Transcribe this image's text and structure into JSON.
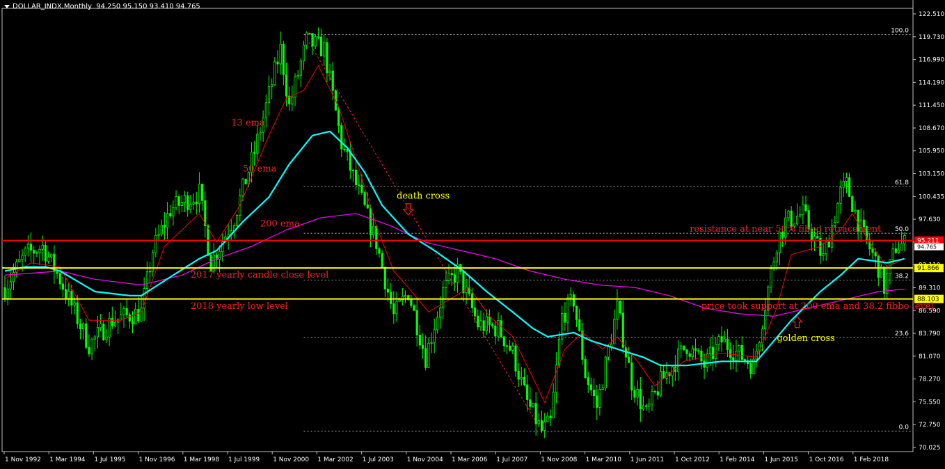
{
  "header": {
    "symbol": "DOLLAR_INDX,Monthly",
    "ohlc": "94.250 95.150 93.410 94.765"
  },
  "colors": {
    "background": "#000000",
    "candle": "#00ff00",
    "ema13": "#ff0000",
    "ema50": "#00ffff",
    "ema200": "#ff00ff",
    "resistance_line": "#ff0000",
    "yearly_lines": "#ffff00",
    "fibo": "#ffffff",
    "annotation_red": "#ff2020",
    "annotation_yellow": "#ffff00"
  },
  "chart_data": {
    "type": "candlestick",
    "title": "DOLLAR_INDX,Monthly",
    "ylim": [
      70.025,
      122.8
    ],
    "xlim": [
      "1992-11",
      "2018-10"
    ],
    "y_ticks": [
      "122.510",
      "119.730",
      "116.990",
      "114.190",
      "111.450",
      "108.670",
      "105.950",
      "103.150",
      "100.435",
      "97.630",
      "94.880",
      "92.110",
      "89.310",
      "86.590",
      "83.790",
      "81.070",
      "78.270",
      "75.550",
      "72.750",
      "70.025"
    ],
    "x_ticks": [
      "1 Nov 1992",
      "1 Mar 1994",
      "1 Jul 1995",
      "1 Nov 1996",
      "1 Mar 1998",
      "1 Jul 1999",
      "1 Nov 2000",
      "1 Mar 2002",
      "1 Jul 2003",
      "1 Nov 2004",
      "1 Mar 2006",
      "1 Jul 2007",
      "1 Nov 2008",
      "1 Mar 2010",
      "1 Jun 2011",
      "1 Oct 2012",
      "1 Feb 2014",
      "1 Jun 2015",
      "1 Oct 2016",
      "1 Feb 2018"
    ],
    "price_path": [
      [
        "1992-11",
        89.5
      ],
      [
        "1993-06",
        93.5
      ],
      [
        "1993-12",
        94.5
      ],
      [
        "1994-06",
        90.5
      ],
      [
        "1995-04",
        82.5
      ],
      [
        "1995-12",
        85.5
      ],
      [
        "1996-10",
        86.5
      ],
      [
        "1997-02",
        94.0
      ],
      [
        "1997-08",
        99.0
      ],
      [
        "1998-06",
        101.0
      ],
      [
        "1998-10",
        92.5
      ],
      [
        "1999-06",
        98.0
      ],
      [
        "2000-01",
        106.0
      ],
      [
        "2000-10",
        118.5
      ],
      [
        "2001-01",
        111.5
      ],
      [
        "2001-07",
        119.5
      ],
      [
        "2002-01",
        118.5
      ],
      [
        "2002-07",
        107.0
      ],
      [
        "2003-01",
        101.0
      ],
      [
        "2003-07",
        95.0
      ],
      [
        "2004-01",
        86.0
      ],
      [
        "2004-06",
        89.0
      ],
      [
        "2004-12",
        81.0
      ],
      [
        "2005-06",
        89.0
      ],
      [
        "2005-11",
        91.5
      ],
      [
        "2006-06",
        85.0
      ],
      [
        "2007-01",
        84.5
      ],
      [
        "2007-06",
        81.5
      ],
      [
        "2007-11",
        75.5
      ],
      [
        "2008-04",
        72.0
      ],
      [
        "2008-07",
        73.0
      ],
      [
        "2008-11",
        86.0
      ],
      [
        "2009-03",
        88.0
      ],
      [
        "2009-07",
        79.0
      ],
      [
        "2009-11",
        75.0
      ],
      [
        "2010-06",
        87.0
      ],
      [
        "2010-11",
        78.0
      ],
      [
        "2011-04",
        74.0
      ],
      [
        "2011-09",
        78.0
      ],
      [
        "2012-06",
        82.5
      ],
      [
        "2012-12",
        80.0
      ],
      [
        "2013-06",
        83.0
      ],
      [
        "2014-05",
        80.0
      ],
      [
        "2015-01",
        95.0
      ],
      [
        "2015-04",
        97.5
      ],
      [
        "2015-10",
        98.5
      ],
      [
        "2016-05",
        93.0
      ],
      [
        "2016-11",
        101.0
      ],
      [
        "2017-01",
        102.0
      ],
      [
        "2017-06",
        96.5
      ],
      [
        "2017-12",
        92.0
      ],
      [
        "2018-02",
        89.5
      ],
      [
        "2018-06",
        94.5
      ],
      [
        "2018-09",
        94.765
      ]
    ],
    "ema13": [
      [
        "1992-11",
        90.5
      ],
      [
        "1993-08",
        92.5
      ],
      [
        "1994-06",
        92.0
      ],
      [
        "1995-04",
        85.5
      ],
      [
        "1996-03",
        85.5
      ],
      [
        "1996-10",
        86.5
      ],
      [
        "1997-06",
        94.5
      ],
      [
        "1998-06",
        98.5
      ],
      [
        "1998-12",
        95.0
      ],
      [
        "1999-08",
        99.5
      ],
      [
        "2000-06",
        108.0
      ],
      [
        "2000-12",
        112.5
      ],
      [
        "2001-06",
        113.5
      ],
      [
        "2001-11",
        116.5
      ],
      [
        "2002-06",
        111.5
      ],
      [
        "2003-01",
        104.0
      ],
      [
        "2003-07",
        97.0
      ],
      [
        "2004-01",
        91.5
      ],
      [
        "2004-06",
        89.5
      ],
      [
        "2005-01",
        86.5
      ],
      [
        "2005-08",
        88.0
      ],
      [
        "2006-03",
        89.5
      ],
      [
        "2006-10",
        86.0
      ],
      [
        "2007-06",
        83.5
      ],
      [
        "2008-01",
        78.5
      ],
      [
        "2008-05",
        75.5
      ],
      [
        "2008-12",
        82.0
      ],
      [
        "2009-06",
        84.0
      ],
      [
        "2010-01",
        82.0
      ],
      [
        "2010-06",
        83.5
      ],
      [
        "2011-01",
        80.5
      ],
      [
        "2011-07",
        77.5
      ],
      [
        "2012-05",
        80.5
      ],
      [
        "2013-06",
        81.5
      ],
      [
        "2014-06",
        81.0
      ],
      [
        "2015-01",
        87.0
      ],
      [
        "2015-06",
        93.5
      ],
      [
        "2016-04",
        94.5
      ],
      [
        "2016-11",
        96.5
      ],
      [
        "2017-03",
        98.5
      ],
      [
        "2017-09",
        95.0
      ],
      [
        "2018-03",
        92.0
      ],
      [
        "2018-09",
        93.0
      ]
    ],
    "ema50": [
      [
        "1992-11",
        91.5
      ],
      [
        "1993-06",
        92.0
      ],
      [
        "1994-01",
        92.0
      ],
      [
        "1994-06",
        91.5
      ],
      [
        "1995-06",
        89.0
      ],
      [
        "1996-06",
        88.5
      ],
      [
        "1996-10",
        88.5
      ],
      [
        "1997-09",
        91.0
      ],
      [
        "1998-06",
        93.0
      ],
      [
        "1998-12",
        94.0
      ],
      [
        "1999-09",
        97.5
      ],
      [
        "2000-06",
        100.5
      ],
      [
        "2001-01",
        104.5
      ],
      [
        "2001-09",
        108.0
      ],
      [
        "2002-03",
        108.5
      ],
      [
        "2002-09",
        106.5
      ],
      [
        "2003-03",
        103.5
      ],
      [
        "2003-09",
        99.5
      ],
      [
        "2004-06",
        96.0
      ],
      [
        "2005-03",
        94.0
      ],
      [
        "2006-01",
        91.5
      ],
      [
        "2006-09",
        89.0
      ],
      [
        "2007-06",
        86.5
      ],
      [
        "2008-01",
        84.5
      ],
      [
        "2008-06",
        83.5
      ],
      [
        "2009-03",
        84.0
      ],
      [
        "2009-09",
        83.0
      ],
      [
        "2010-06",
        82.0
      ],
      [
        "2011-03",
        81.0
      ],
      [
        "2011-09",
        80.0
      ],
      [
        "2012-06",
        80.0
      ],
      [
        "2013-06",
        80.5
      ],
      [
        "2014-06",
        80.5
      ],
      [
        "2015-06",
        85.5
      ],
      [
        "2016-04",
        89.0
      ],
      [
        "2016-11",
        91.0
      ],
      [
        "2017-05",
        93.0
      ],
      [
        "2018-03",
        92.5
      ],
      [
        "2018-09",
        93.0
      ]
    ],
    "ema200": [
      [
        "1992-11",
        91.0
      ],
      [
        "1994-06",
        91.5
      ],
      [
        "1995-06",
        90.5
      ],
      [
        "1996-10",
        89.8
      ],
      [
        "1997-12",
        91.0
      ],
      [
        "1998-12",
        93.0
      ],
      [
        "1999-12",
        94.5
      ],
      [
        "2000-12",
        96.5
      ],
      [
        "2001-12",
        98.0
      ],
      [
        "2002-12",
        98.5
      ],
      [
        "2003-12",
        97.0
      ],
      [
        "2004-12",
        95.0
      ],
      [
        "2005-12",
        94.0
      ],
      [
        "2006-12",
        93.0
      ],
      [
        "2007-12",
        91.5
      ],
      [
        "2008-12",
        90.5
      ],
      [
        "2009-12",
        89.8
      ],
      [
        "2010-12",
        89.5
      ],
      [
        "2011-12",
        88.5
      ],
      [
        "2012-12",
        87.0
      ],
      [
        "2013-12",
        86.3
      ],
      [
        "2014-12",
        86.0
      ],
      [
        "2015-12",
        87.0
      ],
      [
        "2016-12",
        88.0
      ],
      [
        "2017-12",
        89.0
      ],
      [
        "2018-09",
        89.3
      ]
    ],
    "fibo_levels": [
      {
        "label": "100.0",
        "value": 120.3
      },
      {
        "label": "61.8",
        "value": 101.8
      },
      {
        "label": "50.0",
        "value": 96.1
      },
      {
        "label": "38.2",
        "value": 90.4
      },
      {
        "label": "23.6",
        "value": 83.4
      },
      {
        "label": "0.0",
        "value": 72.0
      }
    ],
    "fibo_start": "2001-06",
    "trend_line": [
      [
        "2001-07",
        119.8
      ],
      [
        "2008-04",
        72.0
      ]
    ],
    "horizontal_lines": [
      {
        "name": "resistance",
        "value": 95.211,
        "badge": "95.211",
        "color": "#ff0000"
      },
      {
        "name": "yearly-close",
        "value": 91.866,
        "badge": "91.866",
        "color": "#ffff00"
      },
      {
        "name": "yearly-low",
        "value": 88.103,
        "badge": "88.103",
        "color": "#ffff00"
      }
    ],
    "current_price_badge": "94.765",
    "annotations": [
      {
        "text": "13 ema",
        "color": "#ff2020",
        "at": [
          "1999-05",
          109.2
        ]
      },
      {
        "text": "50 ema",
        "color": "#ff2020",
        "at": [
          "1999-09",
          103.6
        ]
      },
      {
        "text": "200 ema",
        "color": "#ff2020",
        "at": [
          "2000-03",
          96.9
        ]
      },
      {
        "text": "death cross",
        "color": "#ffff00",
        "at": [
          "2004-02",
          100.3
        ]
      },
      {
        "text": "resistance at near 50% fibbo retracement",
        "color": "#ff2020",
        "at": [
          "2012-07",
          96.3
        ]
      },
      {
        "text": "2017 yearly candle close level",
        "color": "#ff2020",
        "at": [
          "1998-03",
          90.7
        ]
      },
      {
        "text": "2018 yearly low level",
        "color": "#ff2020",
        "at": [
          "1998-03",
          86.9
        ]
      },
      {
        "text": "price took support at 200 ema and 38.2 fibbo level",
        "color": "#ff2020",
        "at": [
          "2012-11",
          86.9
        ]
      },
      {
        "text": "golden cross",
        "color": "#ffff00",
        "at": [
          "2015-01",
          83.0
        ]
      }
    ],
    "arrows": [
      {
        "name": "death-cross-arrow",
        "direction": "down",
        "at": [
          "2004-06",
          98.5
        ]
      },
      {
        "name": "golden-cross-arrow",
        "direction": "up",
        "at": [
          "2015-08",
          85.8
        ]
      }
    ]
  }
}
